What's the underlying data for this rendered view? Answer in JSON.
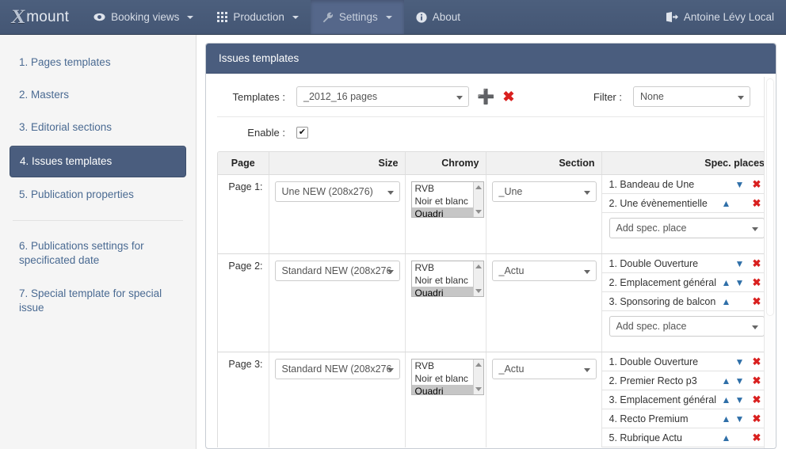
{
  "navbar": {
    "brand_x": "X",
    "brand_word": "mount",
    "items": [
      {
        "label": "Booking views",
        "icon": "eye-icon",
        "caret": true,
        "active": false
      },
      {
        "label": "Production",
        "icon": "grid-icon",
        "caret": true,
        "active": false
      },
      {
        "label": "Settings",
        "icon": "wrench-icon",
        "caret": true,
        "active": true
      },
      {
        "label": "About",
        "icon": "info-icon",
        "caret": false,
        "active": false
      }
    ],
    "user": {
      "label": "Antoine Lévy Local",
      "icon": "logout-icon"
    }
  },
  "sidebar": {
    "items": [
      {
        "label": "1. Pages templates",
        "active": false
      },
      {
        "label": "2. Masters",
        "active": false
      },
      {
        "label": "3. Editorial sections",
        "active": false
      },
      {
        "label": "4. Issues templates",
        "active": true
      },
      {
        "label": "5. Publication properties",
        "active": false
      },
      {
        "label": "6. Publications settings for specificated date",
        "active": false
      },
      {
        "label": "7. Special template for special issue",
        "active": false
      }
    ]
  },
  "panel": {
    "title": "Issues templates",
    "templates_label": "Templates :",
    "templates_value": "_2012_16 pages",
    "add_icon": "plus-icon",
    "delete_icon": "cross-icon",
    "filter_label": "Filter :",
    "filter_value": "None",
    "enable_label": "Enable :",
    "enable_checked": true,
    "enable_check_glyph": "✔"
  },
  "table": {
    "headers": {
      "page": "Page",
      "size": "Size",
      "chromy": "Chromy",
      "section": "Section",
      "spec": "Spec. places"
    },
    "add_spec_placeholder": "Add spec. place",
    "chromy_options": [
      "RVB",
      "Noir et blanc",
      "Quadri"
    ],
    "chromy_selected": "Quadri",
    "rows": [
      {
        "page": "Page 1:",
        "size": "Une NEW (208x276)",
        "section": "_Une",
        "spec_places": [
          {
            "label": "1. Bandeau de Une",
            "up": false,
            "down": true
          },
          {
            "label": "2. Une évènementielle",
            "up": true,
            "down": false
          }
        ]
      },
      {
        "page": "Page 2:",
        "size": "Standard NEW (208x276",
        "section": "_Actu",
        "spec_places": [
          {
            "label": "1. Double Ouverture",
            "up": false,
            "down": true
          },
          {
            "label": "2. Emplacement général",
            "up": true,
            "down": true
          },
          {
            "label": "3. Sponsoring de balcon",
            "up": true,
            "down": false
          }
        ]
      },
      {
        "page": "Page 3:",
        "size": "Standard NEW (208x276",
        "section": "_Actu",
        "spec_places": [
          {
            "label": "1. Double Ouverture",
            "up": false,
            "down": true
          },
          {
            "label": "2. Premier Recto p3",
            "up": true,
            "down": true
          },
          {
            "label": "3. Emplacement général",
            "up": true,
            "down": true
          },
          {
            "label": "4. Recto Premium",
            "up": true,
            "down": true
          },
          {
            "label": "5. Rubrique Actu",
            "up": true,
            "down": false
          }
        ]
      }
    ]
  },
  "colors": {
    "navbar": "#4a5d7e",
    "accent": "#4a5d7e",
    "link": "#4a6a92",
    "add_green": "#29a329",
    "delete_red": "#d9201f",
    "arrow_blue": "#2f6fa8"
  }
}
